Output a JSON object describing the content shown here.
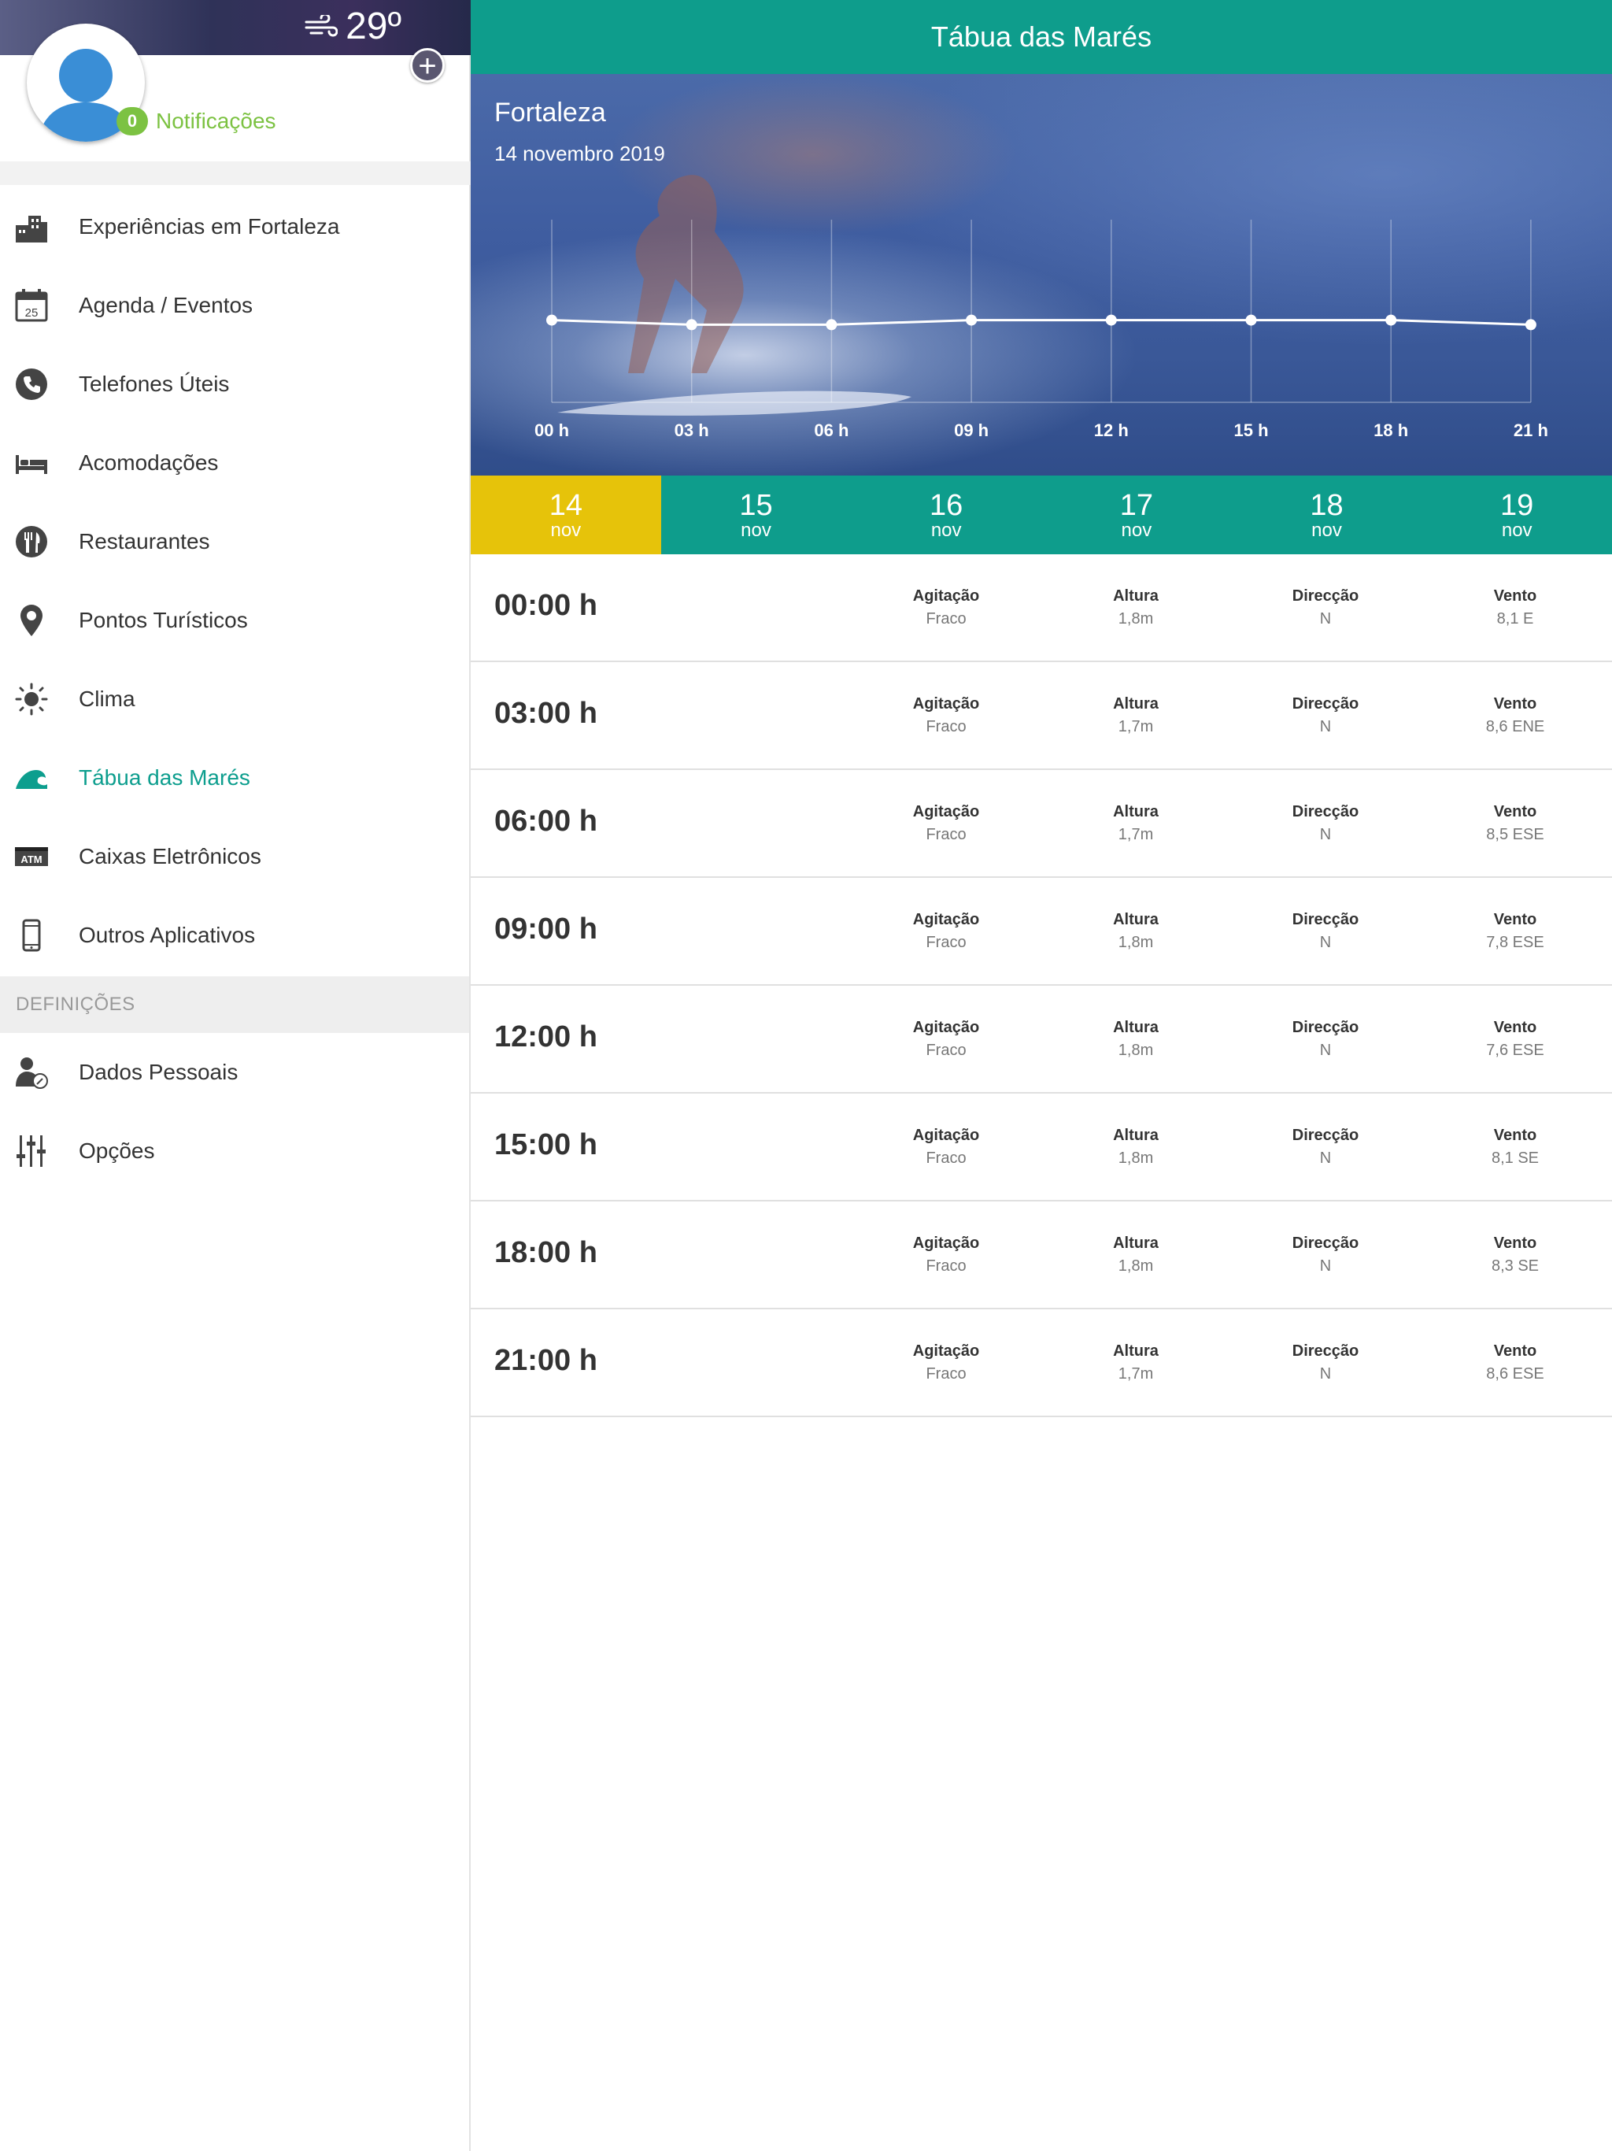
{
  "sidebar": {
    "weather": {
      "temperature": "29º"
    },
    "notifications": {
      "count": "0",
      "label": "Notificações"
    },
    "items": [
      {
        "label": "Experiências em Fortaleza",
        "icon": "city-buildings-icon"
      },
      {
        "label": "Agenda / Eventos",
        "icon": "calendar-icon",
        "icon_text": "25"
      },
      {
        "label": "Telefones Úteis",
        "icon": "phone-icon"
      },
      {
        "label": "Acomodações",
        "icon": "bed-icon"
      },
      {
        "label": "Restaurantes",
        "icon": "fork-knife-icon"
      },
      {
        "label": "Pontos Turísticos",
        "icon": "map-pin-icon"
      },
      {
        "label": "Clima",
        "icon": "sun-icon"
      },
      {
        "label": "Tábua das Marés",
        "icon": "wave-icon",
        "active": true
      },
      {
        "label": "Caixas Eletrônicos",
        "icon": "atm-icon",
        "icon_text": "ATM"
      },
      {
        "label": "Outros Aplicativos",
        "icon": "smartphone-icon"
      }
    ],
    "settings_heading": "DEFINIÇÕES",
    "settings_items": [
      {
        "label": "Dados Pessoais",
        "icon": "user-settings-icon"
      },
      {
        "label": "Opções",
        "icon": "sliders-icon"
      }
    ],
    "colors": {
      "accent": "#0d9e8e",
      "badge": "#7cc242"
    }
  },
  "header": {
    "title": "Tábua das Marés"
  },
  "hero": {
    "city": "Fortaleza",
    "date": "14 novembro 2019"
  },
  "chart_data": {
    "type": "line",
    "x": [
      "00 h",
      "03 h",
      "06 h",
      "09 h",
      "12 h",
      "15 h",
      "18 h",
      "21 h"
    ],
    "series": [
      {
        "values": [
          1.8,
          1.7,
          1.7,
          1.8,
          1.8,
          1.8,
          1.8,
          1.7
        ]
      }
    ],
    "ylim": [
      0,
      4
    ],
    "grid": true
  },
  "days": [
    {
      "num": "14",
      "month": "nov",
      "active": true
    },
    {
      "num": "15",
      "month": "nov"
    },
    {
      "num": "16",
      "month": "nov"
    },
    {
      "num": "17",
      "month": "nov"
    },
    {
      "num": "18",
      "month": "nov"
    },
    {
      "num": "19",
      "month": "nov"
    }
  ],
  "column_labels": {
    "agitation": "Agitação",
    "height": "Altura",
    "direction": "Direcção",
    "wind": "Vento"
  },
  "rows": [
    {
      "time": "00:00 h",
      "agitation": "Fraco",
      "height": "1,8m",
      "direction": "N",
      "wind": "8,1 E"
    },
    {
      "time": "03:00 h",
      "agitation": "Fraco",
      "height": "1,7m",
      "direction": "N",
      "wind": "8,6 ENE"
    },
    {
      "time": "06:00 h",
      "agitation": "Fraco",
      "height": "1,7m",
      "direction": "N",
      "wind": "8,5 ESE"
    },
    {
      "time": "09:00 h",
      "agitation": "Fraco",
      "height": "1,8m",
      "direction": "N",
      "wind": "7,8 ESE"
    },
    {
      "time": "12:00 h",
      "agitation": "Fraco",
      "height": "1,8m",
      "direction": "N",
      "wind": "7,6 ESE"
    },
    {
      "time": "15:00 h",
      "agitation": "Fraco",
      "height": "1,8m",
      "direction": "N",
      "wind": "8,1 SE"
    },
    {
      "time": "18:00 h",
      "agitation": "Fraco",
      "height": "1,8m",
      "direction": "N",
      "wind": "8,3 SE"
    },
    {
      "time": "21:00 h",
      "agitation": "Fraco",
      "height": "1,7m",
      "direction": "N",
      "wind": "8,6 ESE"
    }
  ],
  "colors": {
    "header": "#0e9d8c",
    "active_day": "#e6c30a"
  }
}
